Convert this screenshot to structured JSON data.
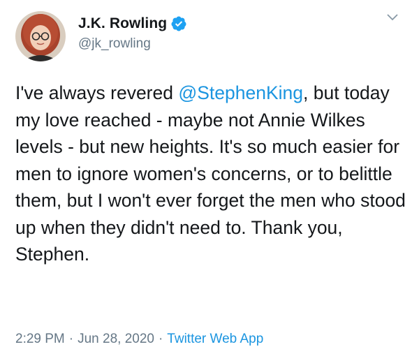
{
  "author": {
    "display_name": "J.K. Rowling",
    "handle": "@jk_rowling",
    "verified": true
  },
  "tweet": {
    "text_before_mention": "I've always revered ",
    "mention": "@StephenKing",
    "text_after_mention": ", but today my love reached - maybe not Annie Wilkes levels - but new heights. It's so much easier for men to ignore women's concerns, or to belittle them, but I won't ever forget the men who stood up when they didn't need to. Thank you, Stephen."
  },
  "meta": {
    "time": "2:29 PM",
    "separator": "·",
    "date": "Jun 28, 2020",
    "source": "Twitter Web App"
  },
  "colors": {
    "link": "#1b95e0",
    "secondary_text": "#657786",
    "primary_text": "#14171a"
  },
  "icons": {
    "verified": "verified-badge-icon",
    "menu": "chevron-down-icon"
  }
}
